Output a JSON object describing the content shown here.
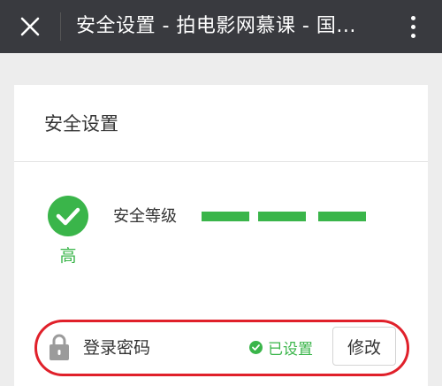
{
  "topbar": {
    "title": "安全设置 - 拍电影网慕课 - 国...",
    "close_icon": "close-icon",
    "more_icon": "more-vertical-icon"
  },
  "card": {
    "title": "安全设置",
    "security_level_label": "安全等级",
    "security_level_value": "高",
    "security_level_bars": 3,
    "check_icon": "check-circle-icon"
  },
  "password": {
    "label": "登录密码",
    "status": "已设置",
    "modify_label": "修改",
    "lock_icon": "lock-icon",
    "status_icon": "check-circle-icon"
  },
  "colors": {
    "topbar": "#393a3f",
    "accent_green": "#3ab54a",
    "highlight_red": "#e0202a"
  }
}
